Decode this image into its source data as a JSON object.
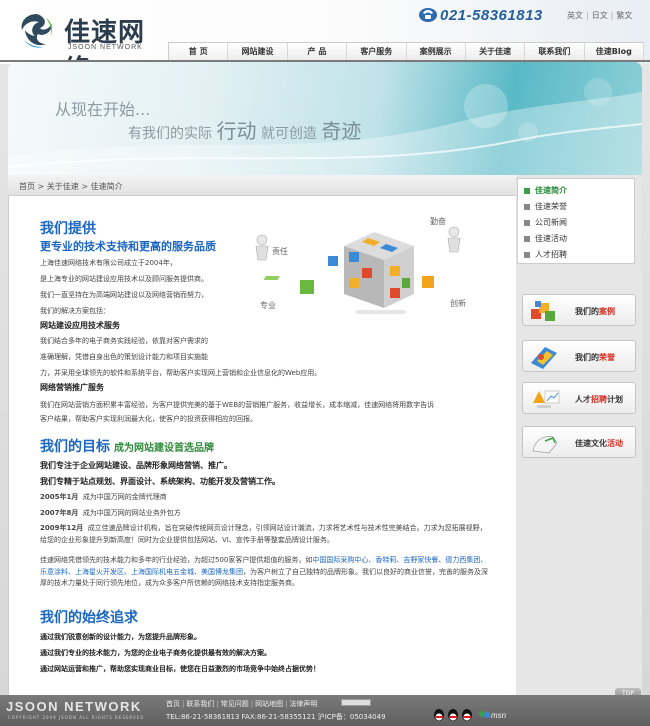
{
  "brand": {
    "name_cn": "佳速网络",
    "name_en": "JSOON NETWORK"
  },
  "header": {
    "phone": "021-58361813",
    "langs": [
      "英文",
      "日文",
      "繁文"
    ]
  },
  "nav": {
    "items": [
      "首 页",
      "网站建设",
      "产 品",
      "客户服务",
      "案例展示",
      "关于佳速",
      "联系我们",
      "佳速Blog"
    ]
  },
  "banner": {
    "line1": "从现在开始...",
    "line2_a": "有我们的实际",
    "line2_b": "行动",
    "line2_c": "就可创造",
    "line2_d": "奇迹"
  },
  "breadcrumb": "首页 > 关于佳速 > 佳速简介",
  "sidebar": {
    "menu": [
      "佳速简介",
      "佳速荣誉",
      "公司新闻",
      "佳速活动",
      "人才招聘"
    ],
    "cards": [
      {
        "pre": "我们的",
        "em": "案例",
        "post": ""
      },
      {
        "pre": "我们的",
        "em": "荣誉",
        "post": ""
      },
      {
        "pre": "人才",
        "em": "招聘",
        "post": "计划"
      },
      {
        "pre": "佳速文化",
        "em": "活动",
        "post": ""
      }
    ]
  },
  "content": {
    "s1_title": "我们提供",
    "s1_subtitle": "更专业的技术支持和更高的服务品质",
    "s1_lines": [
      "上海佳速网络技术有限公司成立于2004年，",
      "是上海专业的网站建设应用技术以及顾问服务提供商。",
      "我们一直坚持在为高端网站建设以及网络营销而努力，",
      "我们的解决方案包括："
    ],
    "s1_h1": "网站建设应用技术服务",
    "s1_h1_lines": [
      "我们结合多年的电子商务实践经验，依靠对客户需求的",
      "准确理解，凭借自身出色的策划设计能力和项目实施能",
      "力，并采用全球领先的软件和系统平台，帮助客户实现网上营销和企业信息化的Web应用。"
    ],
    "s1_h2": "网络营销推广服务",
    "s1_h2_lines": [
      "我们在网站营销方面积累丰富经验，为客户提供完美的基于WEB的营销推广服务，收益增长，成本缩减，佳速网络将用数字告诉",
      "客户结果，帮助客户实现利润最大化，使客户的投资获得相应的回报。"
    ],
    "cube_words": [
      "勤奋",
      "责任",
      "专业",
      "创新"
    ],
    "s2_title": "我们的目标",
    "s2_subtitle": "成为网站建设首选品牌",
    "s2_bold": [
      "我们专注于企业网站建设、品牌形象网络营销、推广。",
      "我们专精于站点规划、界面设计、系统架构、功能开发及营销工作。"
    ],
    "s2_milestones": [
      {
        "date": "2005年1月",
        "text": "成为中国万网的金牌代理商"
      },
      {
        "date": "2007年8月",
        "text": "成为中国万网的网站业务外包方"
      },
      {
        "date": "2009年12月",
        "text": "成立佳速品牌设计机构，旨在突破传统网页设计理念，引领网站设计潮流，力求将艺术性与技术性完美结合。力求为您拓展视野，给您的企业形象提升到新高度！同时为企业提供包括网站、VI、宣传手册等整套品牌设计服务。"
      }
    ],
    "s2_para_a": "佳速网络凭借领先的技术能力和多年的行业经验，为超过500家客户提供超值的服务，如",
    "s2_para_links": "中国国际采购中心、香特莉、吉野家快餐、德力西集团、乐意涂料、上海星火开发区、上海国际机电五金城、美国博龙集团",
    "s2_para_b": "，为客户树立了自己独特的品牌形象。我们以良好的商业信誉，完善的服务及深厚的技术力量处于同行领先地位，成为众多客户所信赖的网络技术支持指定服务商。",
    "s3_title": "我们的始终追求",
    "s3_lines": [
      "通过我们锐意创新的设计能力，为您提升品牌形象。",
      "通过我们专业的技术能力，为您的企业电子商务化提供最有效的解决方案。",
      "通过网站运营和推广，帮助您实现商业目标，使您在日益激烈的市场竞争中始终占据优势！"
    ]
  },
  "footer": {
    "brand": "JSOON NETWORK",
    "copyright": "COPYRIGHT 2009 JSOON ALL RIGHTS RESERVED",
    "links": [
      "首页",
      "联系我们",
      "常见问题",
      "网站地图",
      "法律声明"
    ],
    "contact": "TEL:86-21-58361813   FAX:86-21-58355121   沪ICP备：05034049",
    "top_label": "TOP"
  },
  "colors": {
    "accent_blue": "#1b66c2",
    "accent_green": "#2e8b3a",
    "highlight_red": "#d62b1f"
  }
}
